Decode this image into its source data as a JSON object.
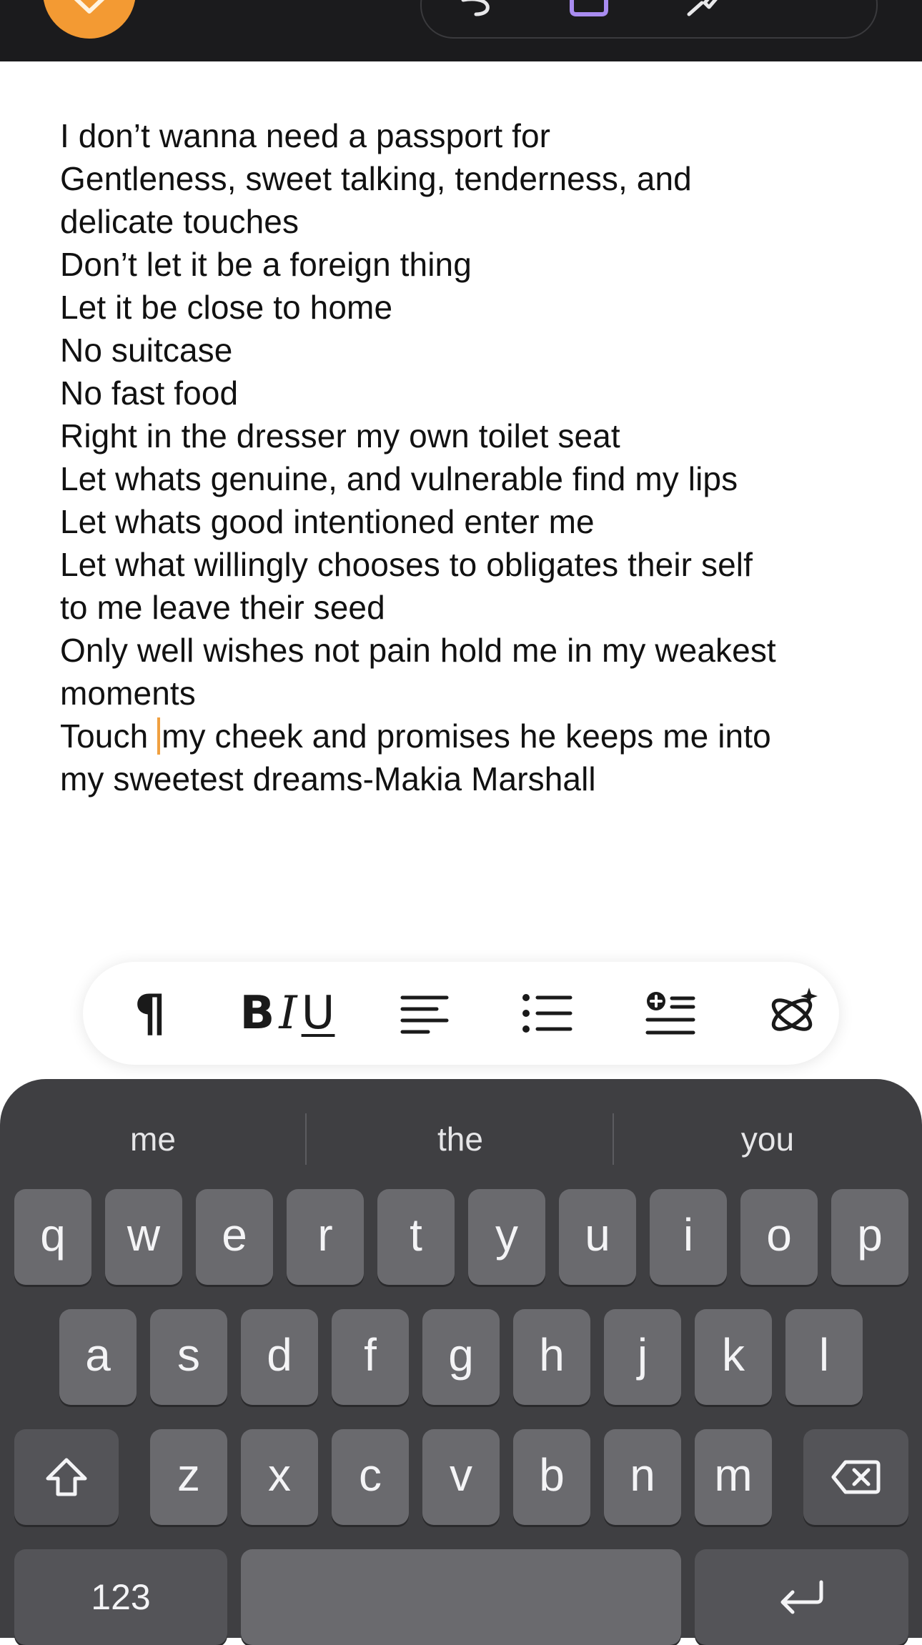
{
  "colors": {
    "accent": "#f39a33",
    "top_bar": "#1b1b1d",
    "caret": "#f0a040",
    "keyboard_bg": "#3f3f42",
    "key_bg": "#6a6a6e",
    "special_key_bg": "#545458"
  },
  "top_bar": {
    "icons": [
      "chevron-down-icon",
      "undo-icon",
      "copy-icon",
      "tools-icon"
    ]
  },
  "document": {
    "lines": [
      "I don’t wanna need a passport for",
      "Gentleness, sweet talking, tenderness, and",
      "delicate touches",
      "Don’t let it be a foreign thing",
      "Let it be close to home",
      "No suitcase",
      "No fast food",
      "Right in the dresser my own toilet seat",
      "Let whats genuine, and vulnerable find my lips",
      "Let whats good intentioned enter me",
      "Let what willingly chooses to obligates their self",
      "to me leave their seed",
      "Only well wishes not pain hold me in my weakest",
      "moments"
    ],
    "caret_line_before": "Touch ",
    "caret_line_after": "my cheek and promises he keeps me into",
    "last_line": "my sweetest dreams-Makia Marshall"
  },
  "format_toolbar": {
    "paragraph_glyph": "¶",
    "bold_glyph": "B",
    "italic_glyph": "I",
    "underline_glyph": "U",
    "icons": [
      "paragraph-icon",
      "bold-italic-underline-icon",
      "align-left-icon",
      "bullet-list-icon",
      "insert-block-icon",
      "ai-sparkle-icon"
    ]
  },
  "keyboard": {
    "suggestions": [
      "me",
      "the",
      "you"
    ],
    "row1": [
      "q",
      "w",
      "e",
      "r",
      "t",
      "y",
      "u",
      "i",
      "o",
      "p"
    ],
    "row2": [
      "a",
      "s",
      "d",
      "f",
      "g",
      "h",
      "j",
      "k",
      "l"
    ],
    "row3": [
      "z",
      "x",
      "c",
      "v",
      "b",
      "n",
      "m"
    ],
    "numbers_label": "123",
    "icons": [
      "shift-icon",
      "backspace-icon",
      "return-icon"
    ]
  }
}
